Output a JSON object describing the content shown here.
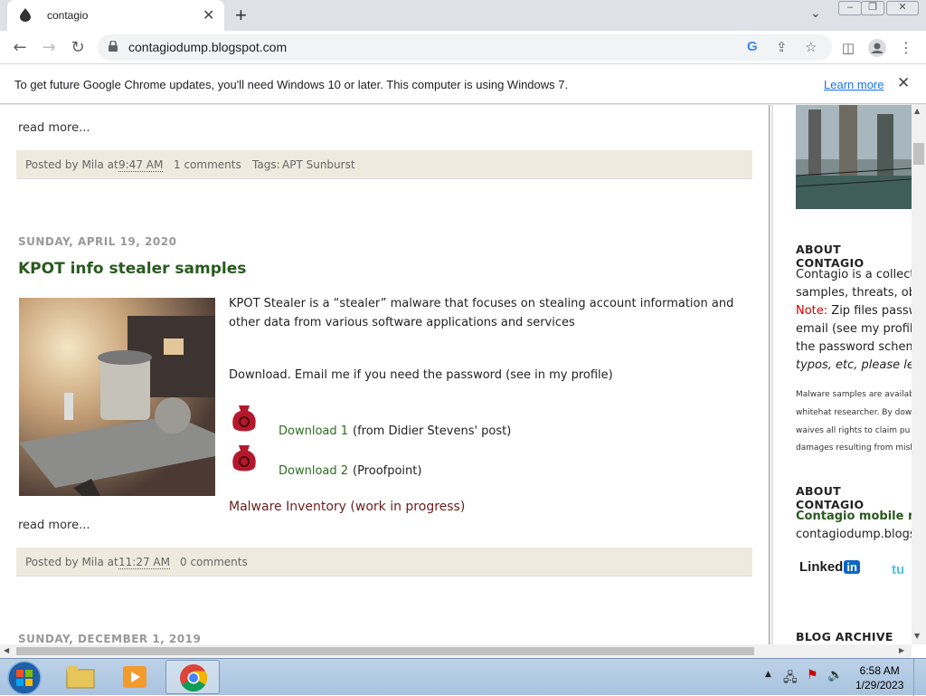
{
  "browser": {
    "tab_title": "contagio",
    "url": "contagiodump.blogspot.com",
    "infobar_message": "To get future Google Chrome updates, you'll need Windows 10 or later. This computer is using Windows 7.",
    "infobar_link": "Learn more"
  },
  "posts": [
    {
      "read_more": "read more...",
      "footer": {
        "posted_by": "Posted by Mila at",
        "time": "9:47 AM",
        "comments": "1 comments",
        "tags_label": "Tags:",
        "tags": "APT Sunburst"
      }
    },
    {
      "date": "SUNDAY, APRIL 19, 2020",
      "title": "KPOT info stealer samples",
      "body_line1": "KPOT Stealer is a “stealer” malware that focuses on stealing account information and",
      "body_line2": "other data from various software applications and services",
      "download_note": "Download. Email me if you need the password (see in my profile)",
      "downloads": [
        {
          "label": "Download 1",
          "note": "(from Didier Stevens' post)"
        },
        {
          "label": "Download 2",
          "note": "(Proofpoint)"
        }
      ],
      "inventory_link": "Malware Inventory (work in progress)",
      "read_more": "read more...",
      "footer": {
        "posted_by": "Posted by Mila at",
        "time": "11:27 AM",
        "comments": "0 comments"
      }
    },
    {
      "date": "SUNDAY, DECEMBER 1, 2019"
    }
  ],
  "sidebar": {
    "about1_heading": "ABOUT CONTAGIO",
    "about1_lines": [
      "Contagio is a collect",
      "samples, threats, ob"
    ],
    "note_label": "Note:",
    "note_rest": " Zip files passw",
    "about1_more": [
      "email (see my profil",
      "the password schem"
    ],
    "about1_italic": "typos, etc, please le",
    "small_lines": [
      "Malware samples are availab",
      "whitehat researcher. By dow",
      "waives all rights to claim pu",
      "damages resulting from mish"
    ],
    "about2_heading": "ABOUT CONTAGIO",
    "mobile_link": "Contagio mobile mi",
    "mobile_url": "contagiodump.blogs",
    "linkedin": "Linked",
    "linkedin_in": "in",
    "archive_heading": "BLOG ARCHIVE"
  },
  "taskbar": {
    "time": "6:58 AM",
    "date": "1/29/2023"
  }
}
